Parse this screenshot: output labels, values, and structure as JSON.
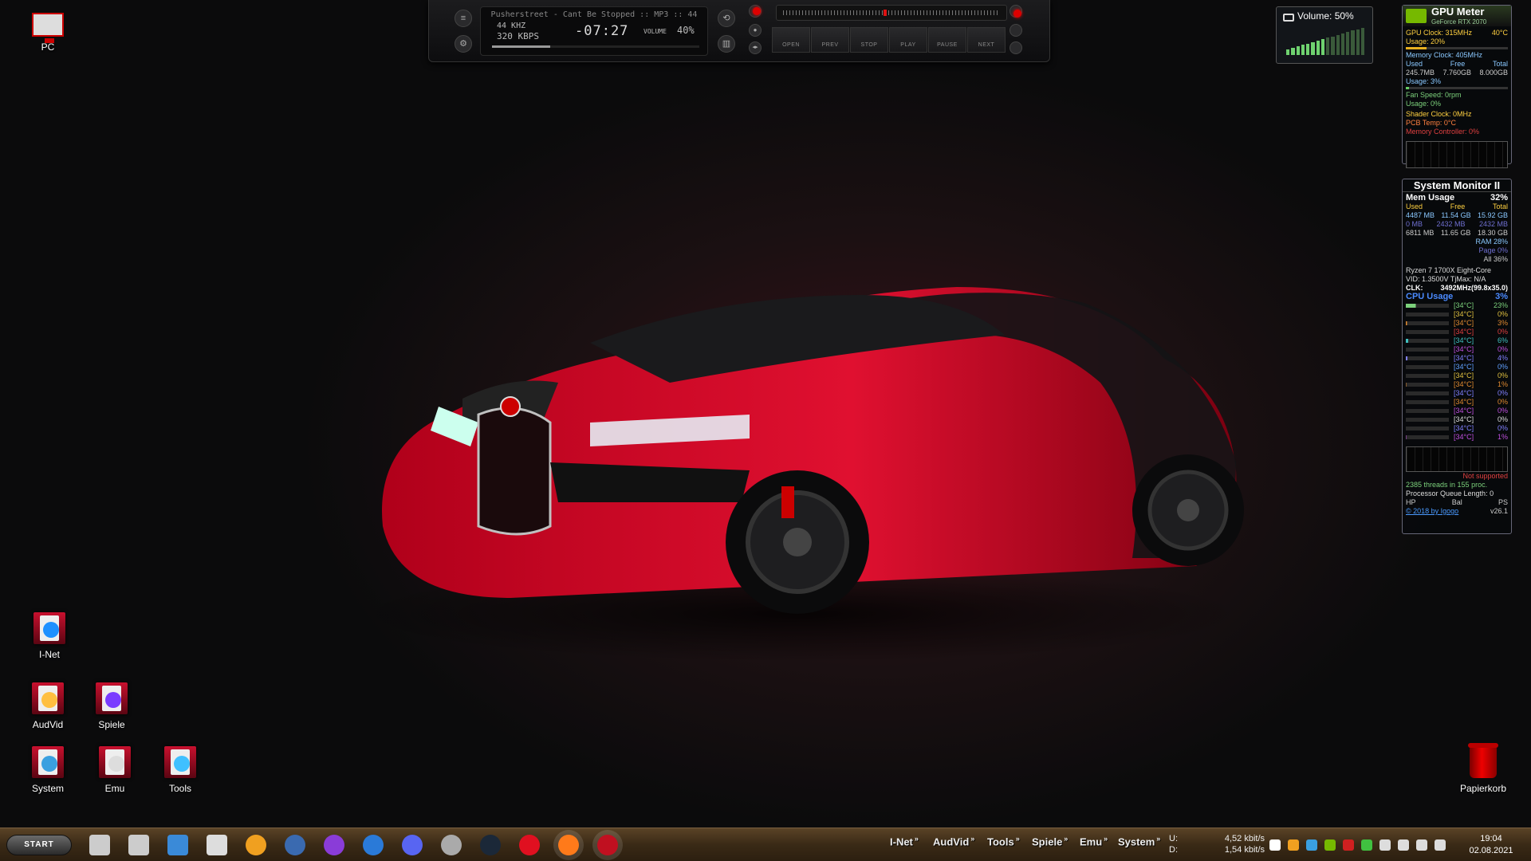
{
  "desktop_icons": [
    {
      "label": "PC",
      "kind": "monitor"
    },
    {
      "label": "I-Net",
      "kind": "folder",
      "color": "#1e90ff"
    },
    {
      "label": "AudVid",
      "kind": "folder",
      "color": "#ffbf40"
    },
    {
      "label": "Spiele",
      "kind": "folder",
      "color": "#7a3cff"
    },
    {
      "label": "System",
      "kind": "folder",
      "color": "#3aa0e0"
    },
    {
      "label": "Emu",
      "kind": "folder",
      "color": "#dddddd"
    },
    {
      "label": "Tools",
      "kind": "folder",
      "color": "#40c0ff"
    },
    {
      "label": "Papierkorb",
      "kind": "trash"
    }
  ],
  "player": {
    "title": "Pusherstreet - Cant Be Stopped :: MP3 :: 44",
    "khz": "44 KHZ",
    "kbps": "320 KBPS",
    "time": "-07:27",
    "volume_label": "VOLUME",
    "volume_value": "40%",
    "seek_progress": 0.28,
    "buttons": [
      "OPEN",
      "PREV",
      "STOP",
      "PLAY",
      "PAUSE",
      "NEXT"
    ]
  },
  "volume_widget": {
    "text": "Volume: 50%",
    "level": 0.5
  },
  "gpu_meter": {
    "title": "GPU Meter",
    "model": "GeForce RTX 2070",
    "gpu_clock": "GPU Clock: 315MHz",
    "temp": "40°C",
    "usage": "Usage: 20%",
    "usage_value": 0.2,
    "memory_clock": "Memory Clock: 405MHz",
    "mem_headers": [
      "Used",
      "Free",
      "Total"
    ],
    "mem_values": [
      "245.7MB",
      "7.760GB",
      "8.000GB"
    ],
    "mem_usage": "Usage: 3%",
    "mem_usage_value": 0.03,
    "fan_speed": "Fan Speed: 0rpm",
    "fan_usage": "Usage: 0%",
    "shader_clock": "Shader Clock: 0MHz",
    "pcb_temp": "PCB Temp: 0°C",
    "mem_controller": "Memory Controller: 0%"
  },
  "system_monitor": {
    "title": "System Monitor II",
    "mem_usage_label": "Mem Usage",
    "mem_usage_value": "32%",
    "mem_headers": [
      "Used",
      "Free",
      "Total"
    ],
    "mem_rows": [
      [
        "4487 MB",
        "11.54 GB",
        "15.92 GB"
      ],
      [
        "0 MB",
        "2432 MB",
        "2432 MB"
      ],
      [
        "6811 MB",
        "11.65 GB",
        "18.30 GB"
      ]
    ],
    "ram": "RAM 28%",
    "page": "Page 0%",
    "all": "All 36%",
    "cpu_name": "Ryzen 7 1700X Eight-Core",
    "vid": "VID: 1.3500V TjMax: N/A",
    "clk_label": "CLK:",
    "clk_value": "3492MHz(99.8x35.0)",
    "cpu_usage_label": "CPU Usage",
    "cpu_usage_value": "3%",
    "cores": [
      {
        "temp": "[34°C]",
        "pct": "23%",
        "color": "#7cd17c"
      },
      {
        "temp": "[34°C]",
        "pct": "0%",
        "color": "#e0c040"
      },
      {
        "temp": "[34°C]",
        "pct": "3%",
        "color": "#e08a30"
      },
      {
        "temp": "[34°C]",
        "pct": "0%",
        "color": "#e04040"
      },
      {
        "temp": "[34°C]",
        "pct": "6%",
        "color": "#40c0c0"
      },
      {
        "temp": "[34°C]",
        "pct": "0%",
        "color": "#c050e0"
      },
      {
        "temp": "[34°C]",
        "pct": "4%",
        "color": "#8080ff"
      },
      {
        "temp": "[34°C]",
        "pct": "0%",
        "color": "#60a0ff"
      },
      {
        "temp": "[34°C]",
        "pct": "0%",
        "color": "#e0c040"
      },
      {
        "temp": "[34°C]",
        "pct": "1%",
        "color": "#e08a30"
      },
      {
        "temp": "[34°C]",
        "pct": "0%",
        "color": "#8080ff"
      },
      {
        "temp": "[34°C]",
        "pct": "0%",
        "color": "#e08a30"
      },
      {
        "temp": "[34°C]",
        "pct": "0%",
        "color": "#c050e0"
      },
      {
        "temp": "[34°C]",
        "pct": "0%",
        "color": "#dddddd"
      },
      {
        "temp": "[34°C]",
        "pct": "0%",
        "color": "#8080ff"
      },
      {
        "temp": "[34°C]",
        "pct": "1%",
        "color": "#c050e0"
      }
    ],
    "not_supported": "Not supported",
    "threads": "2385 threads in 155 proc.",
    "queue": "Processor Queue Length: 0",
    "hp_bal_ps": [
      "HP",
      "Bal",
      "PS"
    ],
    "copyright": "© 2018 by Igogo",
    "version": "v26.1"
  },
  "taskbar": {
    "start": "START",
    "apps": [
      {
        "name": "search-icon",
        "color": "#cccccc"
      },
      {
        "name": "task-view-icon",
        "color": "#cccccc"
      },
      {
        "name": "explorer-icon",
        "color": "#3a8ad8"
      },
      {
        "name": "calculator-icon",
        "color": "#dddddd"
      },
      {
        "name": "aimp-icon",
        "color": "#f0a020"
      },
      {
        "name": "teamspeak-icon",
        "color": "#3a6ab0"
      },
      {
        "name": "browser-purple-icon",
        "color": "#8a3cd8"
      },
      {
        "name": "outlook-icon",
        "color": "#2a7ad8"
      },
      {
        "name": "discord-icon",
        "color": "#5865f2"
      },
      {
        "name": "tool-x-icon",
        "color": "#aaaaaa"
      },
      {
        "name": "steam-icon",
        "color": "#1b2838"
      },
      {
        "name": "opera-icon",
        "color": "#e01020"
      },
      {
        "name": "firefox-icon",
        "color": "#ff7a1a"
      },
      {
        "name": "game-icon",
        "color": "#c01020"
      }
    ],
    "folders": [
      "I-Net",
      "AudVid",
      "Tools",
      "Spiele",
      "Emu",
      "System"
    ],
    "net_up_label": "U:",
    "net_up": "4,52 kbit/s",
    "net_down_label": "D:",
    "net_down": "1,54 kbit/s",
    "tray": [
      {
        "name": "tray-expand-icon",
        "color": "#ffffff"
      },
      {
        "name": "tray-aimp-icon",
        "color": "#f0a020"
      },
      {
        "name": "tray-network-icon",
        "color": "#3aa0e0"
      },
      {
        "name": "tray-nvidia-icon",
        "color": "#76b900"
      },
      {
        "name": "tray-msi-icon",
        "color": "#d02020"
      },
      {
        "name": "tray-security-icon",
        "color": "#40c040"
      },
      {
        "name": "tray-windows-icon",
        "color": "#dddddd"
      },
      {
        "name": "tray-wifi-icon",
        "color": "#dddddd"
      },
      {
        "name": "tray-speaker-icon",
        "color": "#dddddd"
      },
      {
        "name": "tray-notification-icon",
        "color": "#dddddd"
      }
    ],
    "time": "19:04",
    "date": "02.08.2021"
  }
}
